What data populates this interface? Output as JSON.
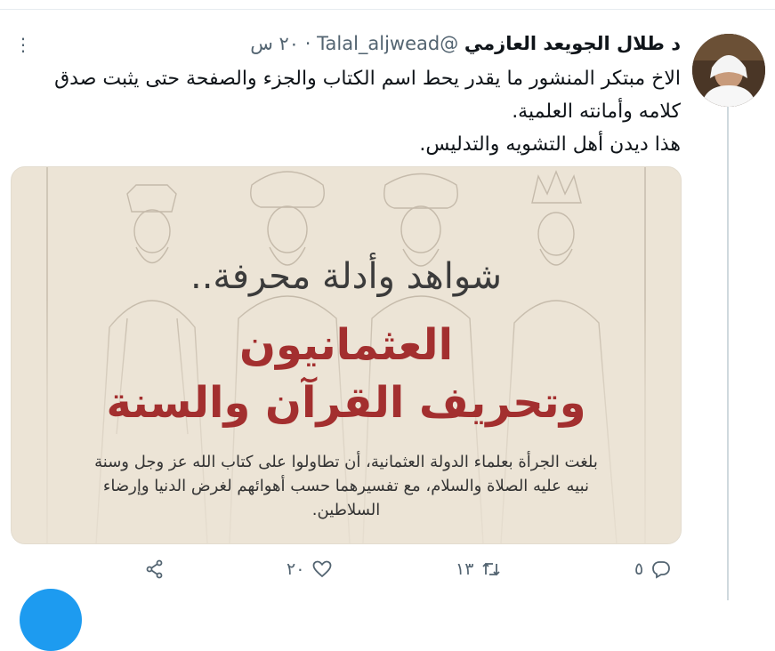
{
  "tweet": {
    "author_name": "د طلال الجويعد العازمي",
    "handle": "@Talal_aljwead",
    "separator": "·",
    "time": "٢٠ س",
    "text": "الاخ مبتكر المنشور ما يقدر يحط اسم الكتاب والجزء والصفحة حتى يثبت صدق كلامه وأمانته العلمية.\nهذا ديدن أهل التشويه والتدليس.",
    "media": {
      "headline": "شواهد وأدلة محرفة..",
      "title_line1": "العثمانيون",
      "title_line2": "وتحريف القرآن والسنة",
      "body": "بلغت الجرأة بعلماء الدولة العثمانية، أن تطاولوا على كتاب الله عز وجل وسنة نبيه عليه الصلاة والسلام، مع تفسيرهما حسب أهوائهم لغرض الدنيا وإرضاء السلاطين."
    },
    "actions": {
      "replies": "٥",
      "retweets": "١٣",
      "likes": "٢٠"
    }
  },
  "colors": {
    "title_red": "#a32f2f",
    "muted": "#536471",
    "accent": "#1d9bf0"
  },
  "icons": [
    "more-icon",
    "reply-icon",
    "retweet-icon",
    "like-icon",
    "share-icon"
  ]
}
